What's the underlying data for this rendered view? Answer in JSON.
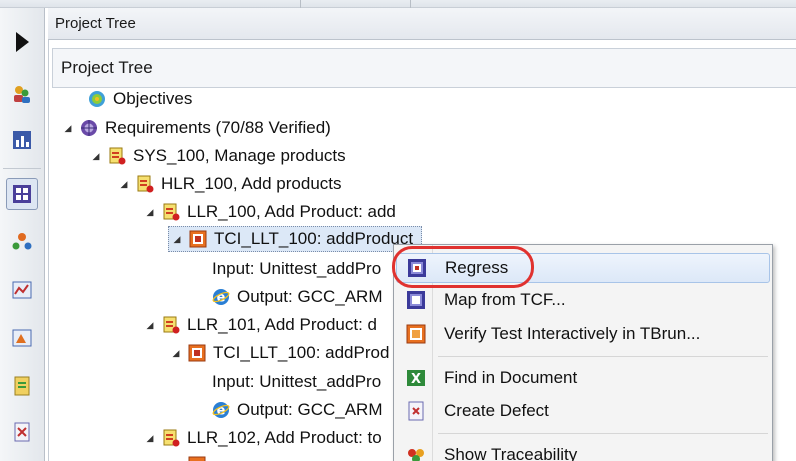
{
  "outer_panel": {
    "title": "Project Tree"
  },
  "inner_panel": {
    "title": "Project Tree"
  },
  "tree": {
    "objectives": "Objectives",
    "requirements": "Requirements (70/88 Verified)",
    "sys100": "SYS_100, Manage products",
    "hlr100": "HLR_100, Add products",
    "llr100": "LLR_100, Add Product: add",
    "tci1": "TCI_LLT_100: addProduct",
    "input1": "Input: Unittest_addPro",
    "output1": "Output: GCC_ARM",
    "llr101": "LLR_101, Add Product: d",
    "tci2": "TCI_LLT_100: addProd",
    "input2": "Input: Unittest_addPro",
    "output2": "Output: GCC_ARM",
    "llr102": "LLR_102, Add Product: to"
  },
  "context_menu": {
    "items": [
      {
        "label": "Regress",
        "icon": "regress-icon"
      },
      {
        "label": "Map from TCF...",
        "icon": "map-icon"
      },
      {
        "label": "Verify Test Interactively in TBrun...",
        "icon": "verify-icon"
      },
      {
        "label": "Find in Document",
        "icon": "excel-icon"
      },
      {
        "label": "Create Defect",
        "icon": "defect-icon"
      },
      {
        "label": "Show Traceability",
        "icon": "traceability-icon"
      }
    ]
  },
  "colors": {
    "selection": "#dce8f7",
    "highlight_ring": "#e0322f",
    "menu_background": "#f4f4f4"
  }
}
